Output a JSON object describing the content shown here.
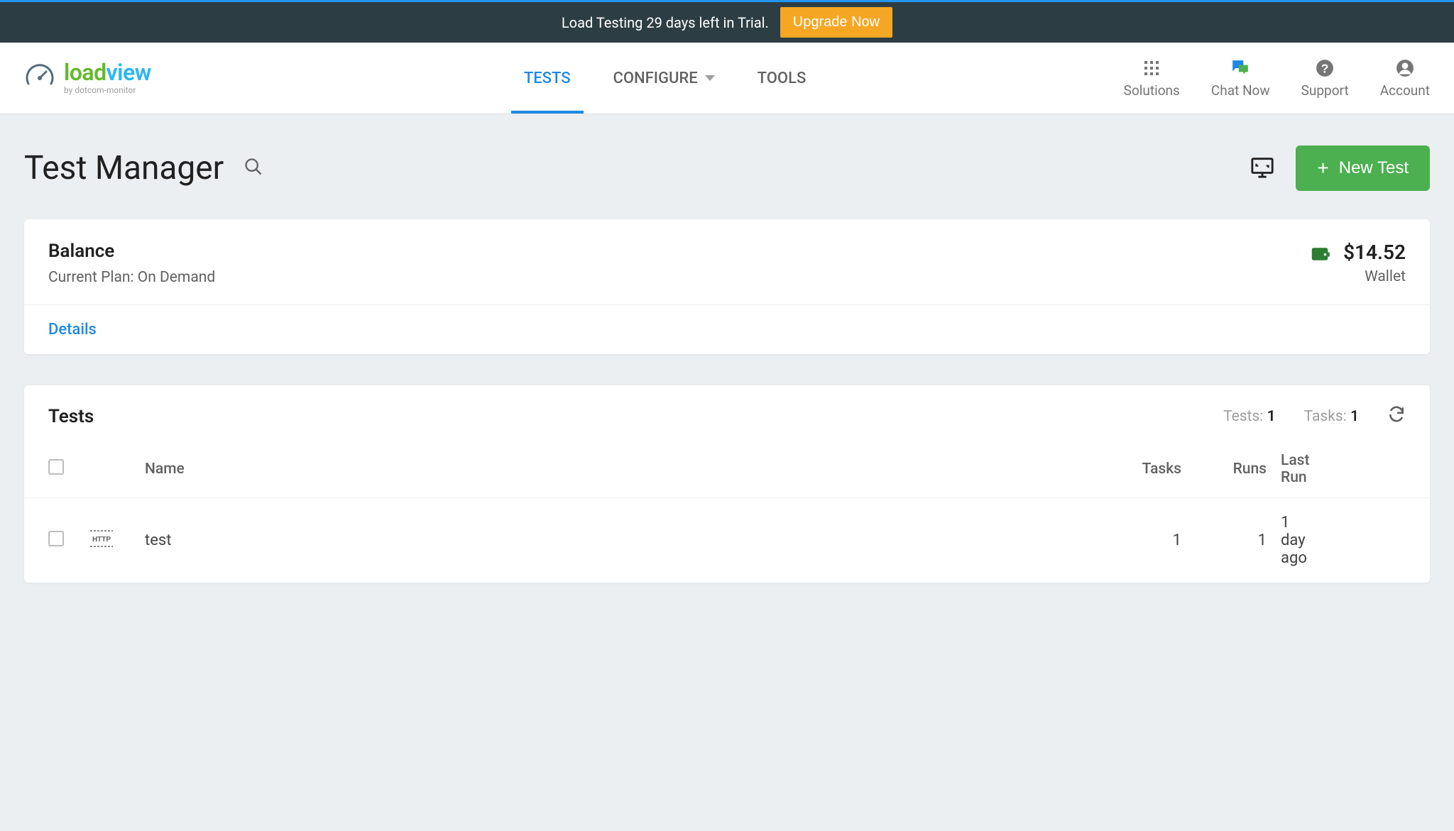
{
  "banner": {
    "message": "Load Testing 29 days left in Trial.",
    "cta": "Upgrade Now"
  },
  "logo": {
    "main_prefix": "load",
    "main_suffix": "view",
    "tagline": "by dotcom-monitor"
  },
  "nav": {
    "tests": "TESTS",
    "configure": "CONFIGURE",
    "tools": "TOOLS"
  },
  "header_actions": {
    "solutions": "Solutions",
    "chat": "Chat Now",
    "support": "Support",
    "account": "Account"
  },
  "page": {
    "title": "Test Manager",
    "new_test_label": "New Test"
  },
  "balance": {
    "title": "Balance",
    "plan_line": "Current Plan: On Demand",
    "amount": "$14.52",
    "wallet_label": "Wallet",
    "details_link": "Details"
  },
  "tests_section": {
    "title": "Tests",
    "tests_label": "Tests:",
    "tests_count": "1",
    "tasks_label": "Tasks:",
    "tasks_count": "1",
    "columns": {
      "name": "Name",
      "tasks": "Tasks",
      "runs": "Runs",
      "last_run": "Last Run"
    },
    "rows": [
      {
        "type": "http",
        "name": "test",
        "tasks": "1",
        "runs": "1",
        "last_run": "1 day ago"
      }
    ]
  }
}
